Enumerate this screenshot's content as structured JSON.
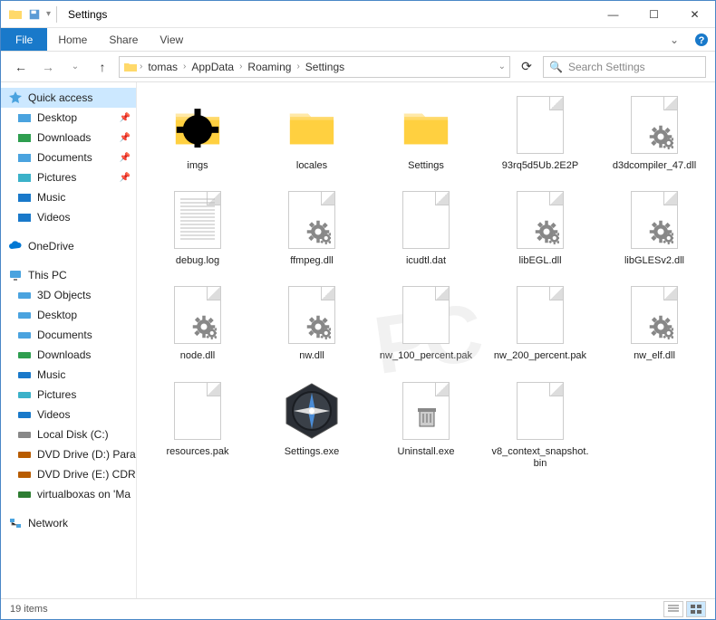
{
  "window": {
    "title": "Settings"
  },
  "ribbon": {
    "file": "File",
    "home": "Home",
    "share": "Share",
    "view": "View"
  },
  "nav": {
    "back": "←",
    "forward": "→",
    "up": "↑"
  },
  "breadcrumbs": [
    "tomas",
    "AppData",
    "Roaming",
    "Settings"
  ],
  "search": {
    "placeholder": "Search Settings"
  },
  "sidebar": {
    "quick_access": "Quick access",
    "qa_items": [
      {
        "label": "Desktop",
        "pin": true
      },
      {
        "label": "Downloads",
        "pin": true
      },
      {
        "label": "Documents",
        "pin": true
      },
      {
        "label": "Pictures",
        "pin": true
      },
      {
        "label": "Music",
        "pin": false
      },
      {
        "label": "Videos",
        "pin": false
      }
    ],
    "onedrive": "OneDrive",
    "this_pc": "This PC",
    "pc_items": [
      "3D Objects",
      "Desktop",
      "Documents",
      "Downloads",
      "Music",
      "Pictures",
      "Videos",
      "Local Disk (C:)",
      "DVD Drive (D:) Paral",
      "DVD Drive (E:) CDRO",
      "virtualboxas on 'Ma"
    ],
    "network": "Network"
  },
  "files": [
    {
      "name": "imgs",
      "type": "folder-gear"
    },
    {
      "name": "locales",
      "type": "folder"
    },
    {
      "name": "Settings",
      "type": "folder"
    },
    {
      "name": "93rq5d5Ub.2E2P",
      "type": "file"
    },
    {
      "name": "d3dcompiler_47.dll",
      "type": "dll"
    },
    {
      "name": "debug.log",
      "type": "log"
    },
    {
      "name": "ffmpeg.dll",
      "type": "dll"
    },
    {
      "name": "icudtl.dat",
      "type": "file"
    },
    {
      "name": "libEGL.dll",
      "type": "dll"
    },
    {
      "name": "libGLESv2.dll",
      "type": "dll"
    },
    {
      "name": "node.dll",
      "type": "dll"
    },
    {
      "name": "nw.dll",
      "type": "dll"
    },
    {
      "name": "nw_100_percent.pak",
      "type": "file"
    },
    {
      "name": "nw_200_percent.pak",
      "type": "file"
    },
    {
      "name": "nw_elf.dll",
      "type": "dll"
    },
    {
      "name": "resources.pak",
      "type": "file"
    },
    {
      "name": "Settings.exe",
      "type": "compass"
    },
    {
      "name": "Uninstall.exe",
      "type": "uninstall"
    },
    {
      "name": "v8_context_snapshot.bin",
      "type": "file"
    }
  ],
  "status": {
    "count": "19 items"
  }
}
